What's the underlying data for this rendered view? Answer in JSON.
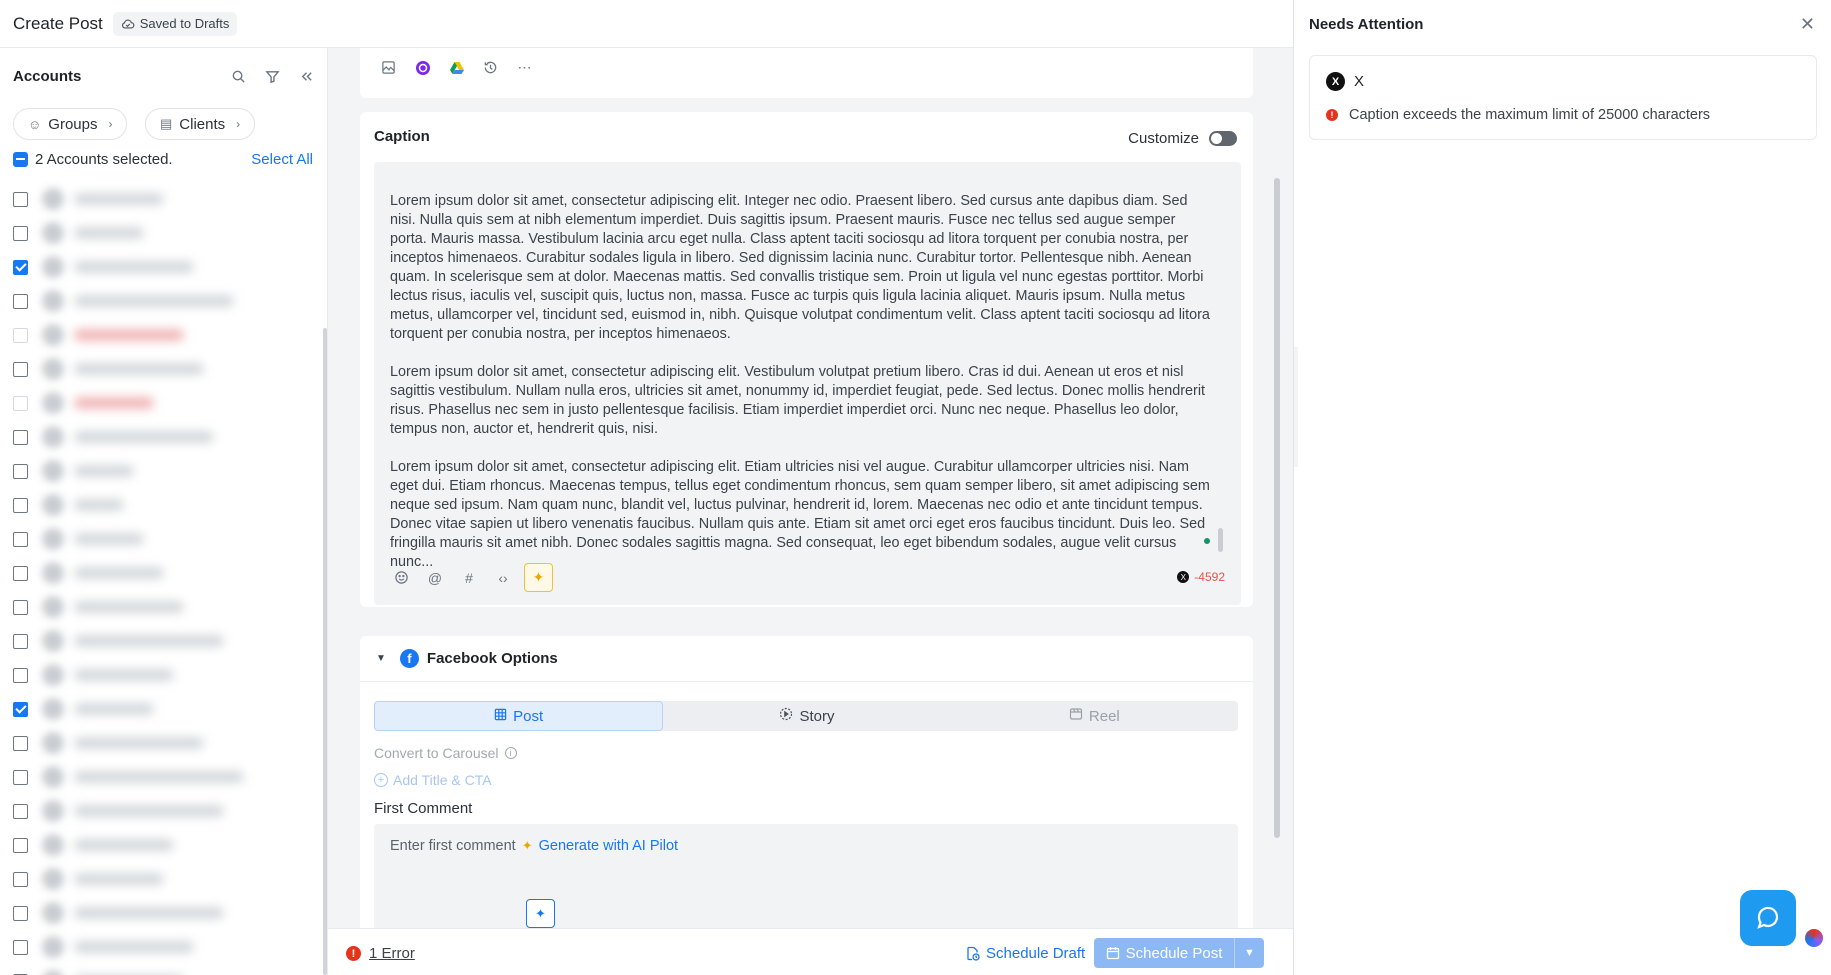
{
  "header": {
    "title": "Create Post",
    "saved_status": "Saved to Drafts"
  },
  "sidebar": {
    "title": "Accounts",
    "chips": {
      "groups": "Groups",
      "clients": "Clients"
    },
    "selected_text": "2 Accounts selected.",
    "select_all": "Select All",
    "account_states": [
      "unchecked",
      "unchecked",
      "checked",
      "unchecked",
      "disabled",
      "unchecked",
      "disabled",
      "unchecked",
      "unchecked",
      "unchecked",
      "unchecked",
      "unchecked",
      "unchecked",
      "unchecked",
      "unchecked",
      "checked",
      "unchecked",
      "unchecked",
      "unchecked",
      "unchecked",
      "unchecked",
      "unchecked",
      "unchecked",
      "unchecked"
    ]
  },
  "toolbar": {
    "icons": [
      "media-library-icon",
      "canva-icon",
      "google-drive-icon",
      "history-icon",
      "more-icon"
    ]
  },
  "caption": {
    "title": "Caption",
    "customize_label": "Customize",
    "paragraphs": [
      "Lorem ipsum dolor sit amet, consectetur adipiscing elit. Integer nec odio. Praesent libero. Sed cursus ante dapibus diam. Sed nisi. Nulla quis sem at nibh elementum imperdiet. Duis sagittis ipsum. Praesent mauris. Fusce nec tellus sed augue semper porta. Mauris massa. Vestibulum lacinia arcu eget nulla. Class aptent taciti sociosqu ad litora torquent per conubia nostra, per inceptos himenaeos. Curabitur sodales ligula in libero. Sed dignissim lacinia nunc. Curabitur tortor. Pellentesque nibh. Aenean quam. In scelerisque sem at dolor. Maecenas mattis. Sed convallis tristique sem. Proin ut ligula vel nunc egestas porttitor. Morbi lectus risus, iaculis vel, suscipit quis, luctus non, massa. Fusce ac turpis quis ligula lacinia aliquet. Mauris ipsum. Nulla metus metus, ullamcorper vel, tincidunt sed, euismod in, nibh. Quisque volutpat condimentum velit. Class aptent taciti sociosqu ad litora torquent per conubia nostra, per inceptos himenaeos.",
      "Lorem ipsum dolor sit amet, consectetur adipiscing elit. Vestibulum volutpat pretium libero. Cras id dui. Aenean ut eros et nisl sagittis vestibulum. Nullam nulla eros, ultricies sit amet, nonummy id, imperdiet feugiat, pede. Sed lectus. Donec mollis hendrerit risus. Phasellus nec sem in justo pellentesque facilisis. Etiam imperdiet imperdiet orci. Nunc nec neque. Phasellus leo dolor, tempus non, auctor et, hendrerit quis, nisi.",
      "Lorem ipsum dolor sit amet, consectetur adipiscing elit. Etiam ultricies nisi vel augue. Curabitur ullamcorper ultricies nisi. Nam eget dui. Etiam rhoncus. Maecenas tempus, tellus eget condimentum rhoncus, sem quam semper libero, sit amet adipiscing sem neque sed ipsum. Nam quam nunc, blandit vel, luctus pulvinar, hendrerit id, lorem. Maecenas nec odio et ante tincidunt tempus. Donec vitae sapien ut libero venenatis faucibus. Nullam quis ante. Etiam sit amet orci eget eros faucibus tincidunt. Duis leo. Sed fringilla mauris sit amet nibh. Donec sodales sagittis magna. Sed consequat, leo eget bibendum sodales, augue velit cursus nunc..."
    ],
    "char_count": "-4592"
  },
  "facebook": {
    "title": "Facebook Options",
    "tabs": {
      "post": "Post",
      "story": "Story",
      "reel": "Reel"
    },
    "convert_carousel": "Convert to Carousel",
    "add_title_cta": "Add Title & CTA",
    "first_comment_label": "First Comment",
    "first_comment_placeholder": "Enter first comment",
    "generate_ai": "Generate with AI Pilot"
  },
  "footer": {
    "error_count": "1 Error",
    "schedule_draft": "Schedule Draft",
    "schedule_post": "Schedule Post"
  },
  "attention": {
    "title": "Needs Attention",
    "network": "X",
    "message": "Caption exceeds the maximum limit of 25000 characters"
  },
  "colors": {
    "accent": "#1877f2",
    "error": "#e5341b",
    "ai_highlight": "#f0c040",
    "help_button": "#1e9bf0"
  }
}
